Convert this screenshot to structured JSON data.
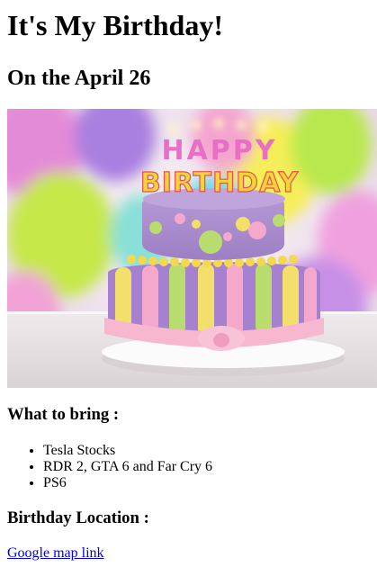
{
  "heading": "It's My Birthday!",
  "subheading": "On the April 26",
  "cake_text": {
    "top_line": "HAPPY",
    "bottom_line": "BIRTHDAY"
  },
  "bring": {
    "title": "What to bring :",
    "items": [
      "Tesla Stocks",
      "RDR 2, GTA 6 and Far Cry 6",
      "PS6"
    ]
  },
  "location": {
    "title": "Birthday Location :",
    "link_label": "Google map link"
  }
}
